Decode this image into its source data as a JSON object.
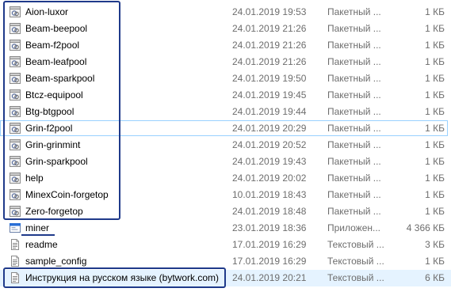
{
  "files": [
    {
      "name": "Aion-luxor",
      "date": "24.01.2019 19:53",
      "type": "Пакетный ...",
      "size": "1 КБ",
      "icon": "batch-file-icon"
    },
    {
      "name": "Beam-beepool",
      "date": "24.01.2019 21:26",
      "type": "Пакетный ...",
      "size": "1 КБ",
      "icon": "batch-file-icon"
    },
    {
      "name": "Beam-f2pool",
      "date": "24.01.2019 21:26",
      "type": "Пакетный ...",
      "size": "1 КБ",
      "icon": "batch-file-icon"
    },
    {
      "name": "Beam-leafpool",
      "date": "24.01.2019 21:26",
      "type": "Пакетный ...",
      "size": "1 КБ",
      "icon": "batch-file-icon"
    },
    {
      "name": "Beam-sparkpool",
      "date": "24.01.2019 19:50",
      "type": "Пакетный ...",
      "size": "1 КБ",
      "icon": "batch-file-icon"
    },
    {
      "name": "Btcz-equipool",
      "date": "24.01.2019 19:45",
      "type": "Пакетный ...",
      "size": "1 КБ",
      "icon": "batch-file-icon"
    },
    {
      "name": "Btg-btgpool",
      "date": "24.01.2019 19:44",
      "type": "Пакетный ...",
      "size": "1 КБ",
      "icon": "batch-file-icon"
    },
    {
      "name": "Grin-f2pool",
      "date": "24.01.2019 20:29",
      "type": "Пакетный ...",
      "size": "1 КБ",
      "icon": "batch-file-icon"
    },
    {
      "name": "Grin-grinmint",
      "date": "24.01.2019 20:52",
      "type": "Пакетный ...",
      "size": "1 КБ",
      "icon": "batch-file-icon"
    },
    {
      "name": "Grin-sparkpool",
      "date": "24.01.2019 19:43",
      "type": "Пакетный ...",
      "size": "1 КБ",
      "icon": "batch-file-icon"
    },
    {
      "name": "help",
      "date": "24.01.2019 20:02",
      "type": "Пакетный ...",
      "size": "1 КБ",
      "icon": "batch-file-icon"
    },
    {
      "name": "MinexCoin-forgetop",
      "date": "10.01.2019 18:43",
      "type": "Пакетный ...",
      "size": "1 КБ",
      "icon": "batch-file-icon"
    },
    {
      "name": "Zero-forgetop",
      "date": "24.01.2019 18:48",
      "type": "Пакетный ...",
      "size": "1 КБ",
      "icon": "batch-file-icon"
    },
    {
      "name": "miner",
      "date": "23.01.2019 18:36",
      "type": "Приложен...",
      "size": "4 366 КБ",
      "icon": "application-icon"
    },
    {
      "name": "readme",
      "date": "17.01.2019 16:29",
      "type": "Текстовый ...",
      "size": "3 КБ",
      "icon": "text-file-icon"
    },
    {
      "name": "sample_config",
      "date": "17.01.2019 16:29",
      "type": "Текстовый ...",
      "size": "1 КБ",
      "icon": "text-file-icon"
    },
    {
      "name": "Инструкция на русском языке (bytwork.com)",
      "date": "24.01.2019 20:21",
      "type": "Текстовый ...",
      "size": "6 КБ",
      "icon": "text-file-icon"
    }
  ],
  "selected_row": "Grin-f2pool",
  "hovered_row": "Инструкция на русском языке (bytwork.com)",
  "colors": {
    "annotation": "#1f3a8a",
    "hover": "#e5f3ff",
    "selection_border": "#99d1ff",
    "secondary_text": "#6d6d6d"
  }
}
